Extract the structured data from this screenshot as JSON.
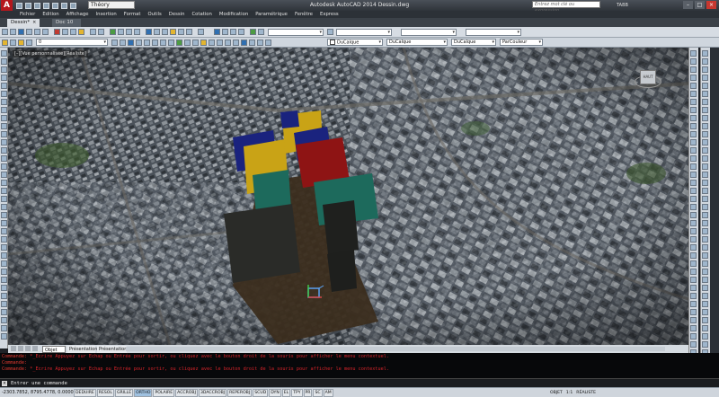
{
  "app": {
    "window_title": "Autodesk AutoCAD 2014   Dessin.dwg",
    "logo_letter": "A",
    "workspace": "Théory",
    "help_search_placeholder": "Entrez mot clé ou expression",
    "signin_label": "TABB"
  },
  "menu": [
    "Fichier",
    "Edition",
    "Affichage",
    "Insertion",
    "Format",
    "Outils",
    "Dessin",
    "Cotation",
    "Modification",
    "Paramétrique",
    "Fenêtre",
    "Express"
  ],
  "file_tabs": [
    {
      "label": "Dessin*",
      "active": true
    },
    {
      "label": "Doc 10",
      "active": false
    }
  ],
  "properties": {
    "layer": "0",
    "color": "DuCalque",
    "linetype": "DuCalque",
    "lineweight": "DuCalque",
    "plotstyle": "ParCouleur"
  },
  "viewport": {
    "label": "[–][Vue personnalisée][Réaliste]",
    "viewcube_face": "HAUT",
    "colors": {
      "blue": "#1a237e",
      "yellow": "#c9a316",
      "red": "#8e1414",
      "teal": "#1d6a5c",
      "dark": "#2a2b28",
      "slab": "#3b2d1d"
    }
  },
  "layout_tabs": [
    "Objet",
    "Présentation1",
    "Présentation2"
  ],
  "command_history": [
    {
      "prefix": "Commande:",
      "text": "*_Ecrire Appuyez sur Echap ou Entrée pour sortir, ou cliquez avec le bouton droit de la souris pour afficher le menu contextuel."
    },
    {
      "prefix": "Commande:",
      "text": ""
    },
    {
      "prefix": "Commande:",
      "text": "*_Ecrire Appuyez sur Echap ou Entrée pour sortir, ou cliquez avec le bouton droit de la souris pour afficher le menu contextuel."
    }
  ],
  "command_input": "Entrer une commande",
  "status": {
    "coordinates": "-2303.7852, 8795.4778, 0.0000",
    "toggles": [
      {
        "label": "DEDUIRE",
        "on": false
      },
      {
        "label": "RESOL",
        "on": false
      },
      {
        "label": "GRILLE",
        "on": false
      },
      {
        "label": "ORTHO",
        "on": true
      },
      {
        "label": "POLAIRE",
        "on": false
      },
      {
        "label": "ACCROBJ",
        "on": false
      },
      {
        "label": "3DACCROBJ",
        "on": false
      },
      {
        "label": "REPEROBJ",
        "on": false
      },
      {
        "label": "SCUD",
        "on": false
      },
      {
        "label": "DYN",
        "on": false
      },
      {
        "label": "EL",
        "on": false
      },
      {
        "label": "TPY",
        "on": false
      },
      {
        "label": "PR",
        "on": false
      },
      {
        "label": "SC",
        "on": false
      },
      {
        "label": "AM",
        "on": false
      }
    ],
    "right": [
      "OBJET",
      "1:1",
      "RÉALISTE"
    ]
  }
}
